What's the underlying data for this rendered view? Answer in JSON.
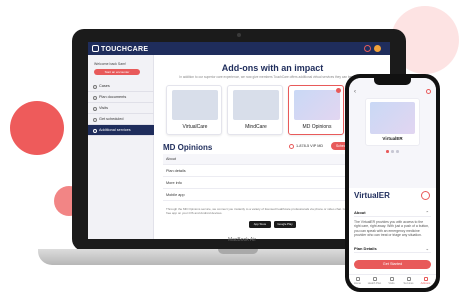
{
  "laptop": {
    "brand_label": "MacBook Air",
    "app": {
      "logo_text": "TOUCHCARE",
      "sidebar": {
        "welcome": "Welcome back Sam!",
        "primary_button": "Start an encounter",
        "items": [
          {
            "label": "Cases",
            "active": false
          },
          {
            "label": "Plan documents",
            "active": false
          },
          {
            "label": "Visits",
            "active": false
          },
          {
            "label": "Get scheduled",
            "active": false
          },
          {
            "label": "Additional services",
            "active": true
          }
        ]
      },
      "main": {
        "title": "Add-ons with an impact",
        "subtitle": "In addition to our superior care experience, we now give members TouchCare offers additional virtual services they can benefit from.",
        "cards": [
          {
            "label": "VirtualCare",
            "selected": false
          },
          {
            "label": "MindCare",
            "selected": false
          },
          {
            "label": "MD Opinions",
            "selected": true
          }
        ],
        "section_title": "MD Opinions",
        "phone_number": "1-878-5 VIP MD",
        "upgrade_button": "Schedule a consultation",
        "accordion": [
          "About",
          "Plan details",
          "More info",
          "Mobile app"
        ],
        "mobile_description": "Through the MD Opinions service, we connect you instantly to a variety of licensed healthcare professionals via phone or video chat. Get started by downloading our free app on your iOS and Android devices.",
        "store_badges": [
          "App Store",
          "Google Play"
        ]
      }
    }
  },
  "phone": {
    "back_icon": "chevron-left-icon",
    "card_label": "VirtualER",
    "title": "VirtualER",
    "about_label": "About",
    "about_text": "The VirtualER provides you with access to the right care, right away. With just a push of a button, you can speak with an emergency medicine provider who can treat or triage any situation.",
    "plan_label": "Plan Details",
    "cta_label": "Get Started",
    "tabs": [
      {
        "label": "Home",
        "active": false
      },
      {
        "label": "Health Plan",
        "active": false
      },
      {
        "label": "Visits",
        "active": false
      },
      {
        "label": "Services",
        "active": false
      },
      {
        "label": "Add-ons",
        "active": true
      }
    ]
  },
  "colors": {
    "navy": "#1f2d5c",
    "accent": "#e85a5a",
    "decor_red": "#ee5b5b",
    "decor_pink": "#fde3e3"
  }
}
